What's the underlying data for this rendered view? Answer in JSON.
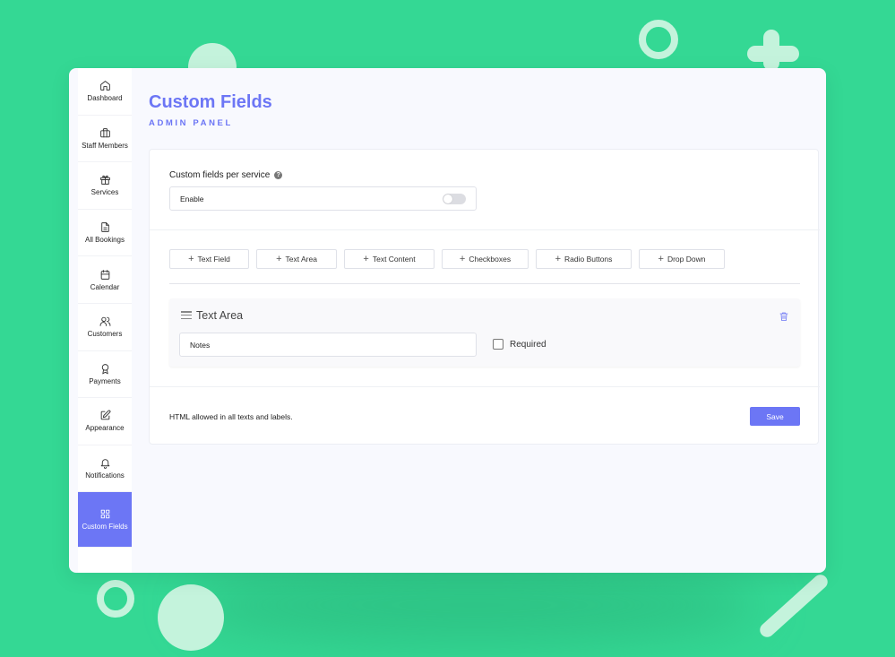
{
  "page": {
    "title": "Custom Fields",
    "subtitle": "ADMIN PANEL"
  },
  "sidebar": {
    "items": [
      {
        "label": "Dashboard",
        "icon": "home-icon"
      },
      {
        "label": "Staff Members",
        "icon": "briefcase-icon"
      },
      {
        "label": "Services",
        "icon": "gift-icon"
      },
      {
        "label": "All Bookings",
        "icon": "document-icon"
      },
      {
        "label": "Calendar",
        "icon": "calendar-icon"
      },
      {
        "label": "Customers",
        "icon": "users-icon"
      },
      {
        "label": "Payments",
        "icon": "award-icon"
      },
      {
        "label": "Appearance",
        "icon": "edit-icon"
      },
      {
        "label": "Notifications",
        "icon": "bell-icon"
      },
      {
        "label": "Custom Fields",
        "icon": "grid-icon",
        "active": true
      }
    ]
  },
  "settings": {
    "per_service_label": "Custom fields per service",
    "help_icon": "question-icon",
    "enable_label": "Enable",
    "enabled": false
  },
  "add_buttons": [
    {
      "label": "Text Field"
    },
    {
      "label": "Text Area"
    },
    {
      "label": "Text Content"
    },
    {
      "label": "Checkboxes"
    },
    {
      "label": "Radio Buttons"
    },
    {
      "label": "Drop Down"
    }
  ],
  "field": {
    "title": "Text Area",
    "value": "Notes",
    "required_label": "Required",
    "required": false
  },
  "footer": {
    "note": "HTML allowed in all texts and labels.",
    "save_label": "Save"
  },
  "colors": {
    "background": "#34d894",
    "accent": "#6c76f5"
  }
}
